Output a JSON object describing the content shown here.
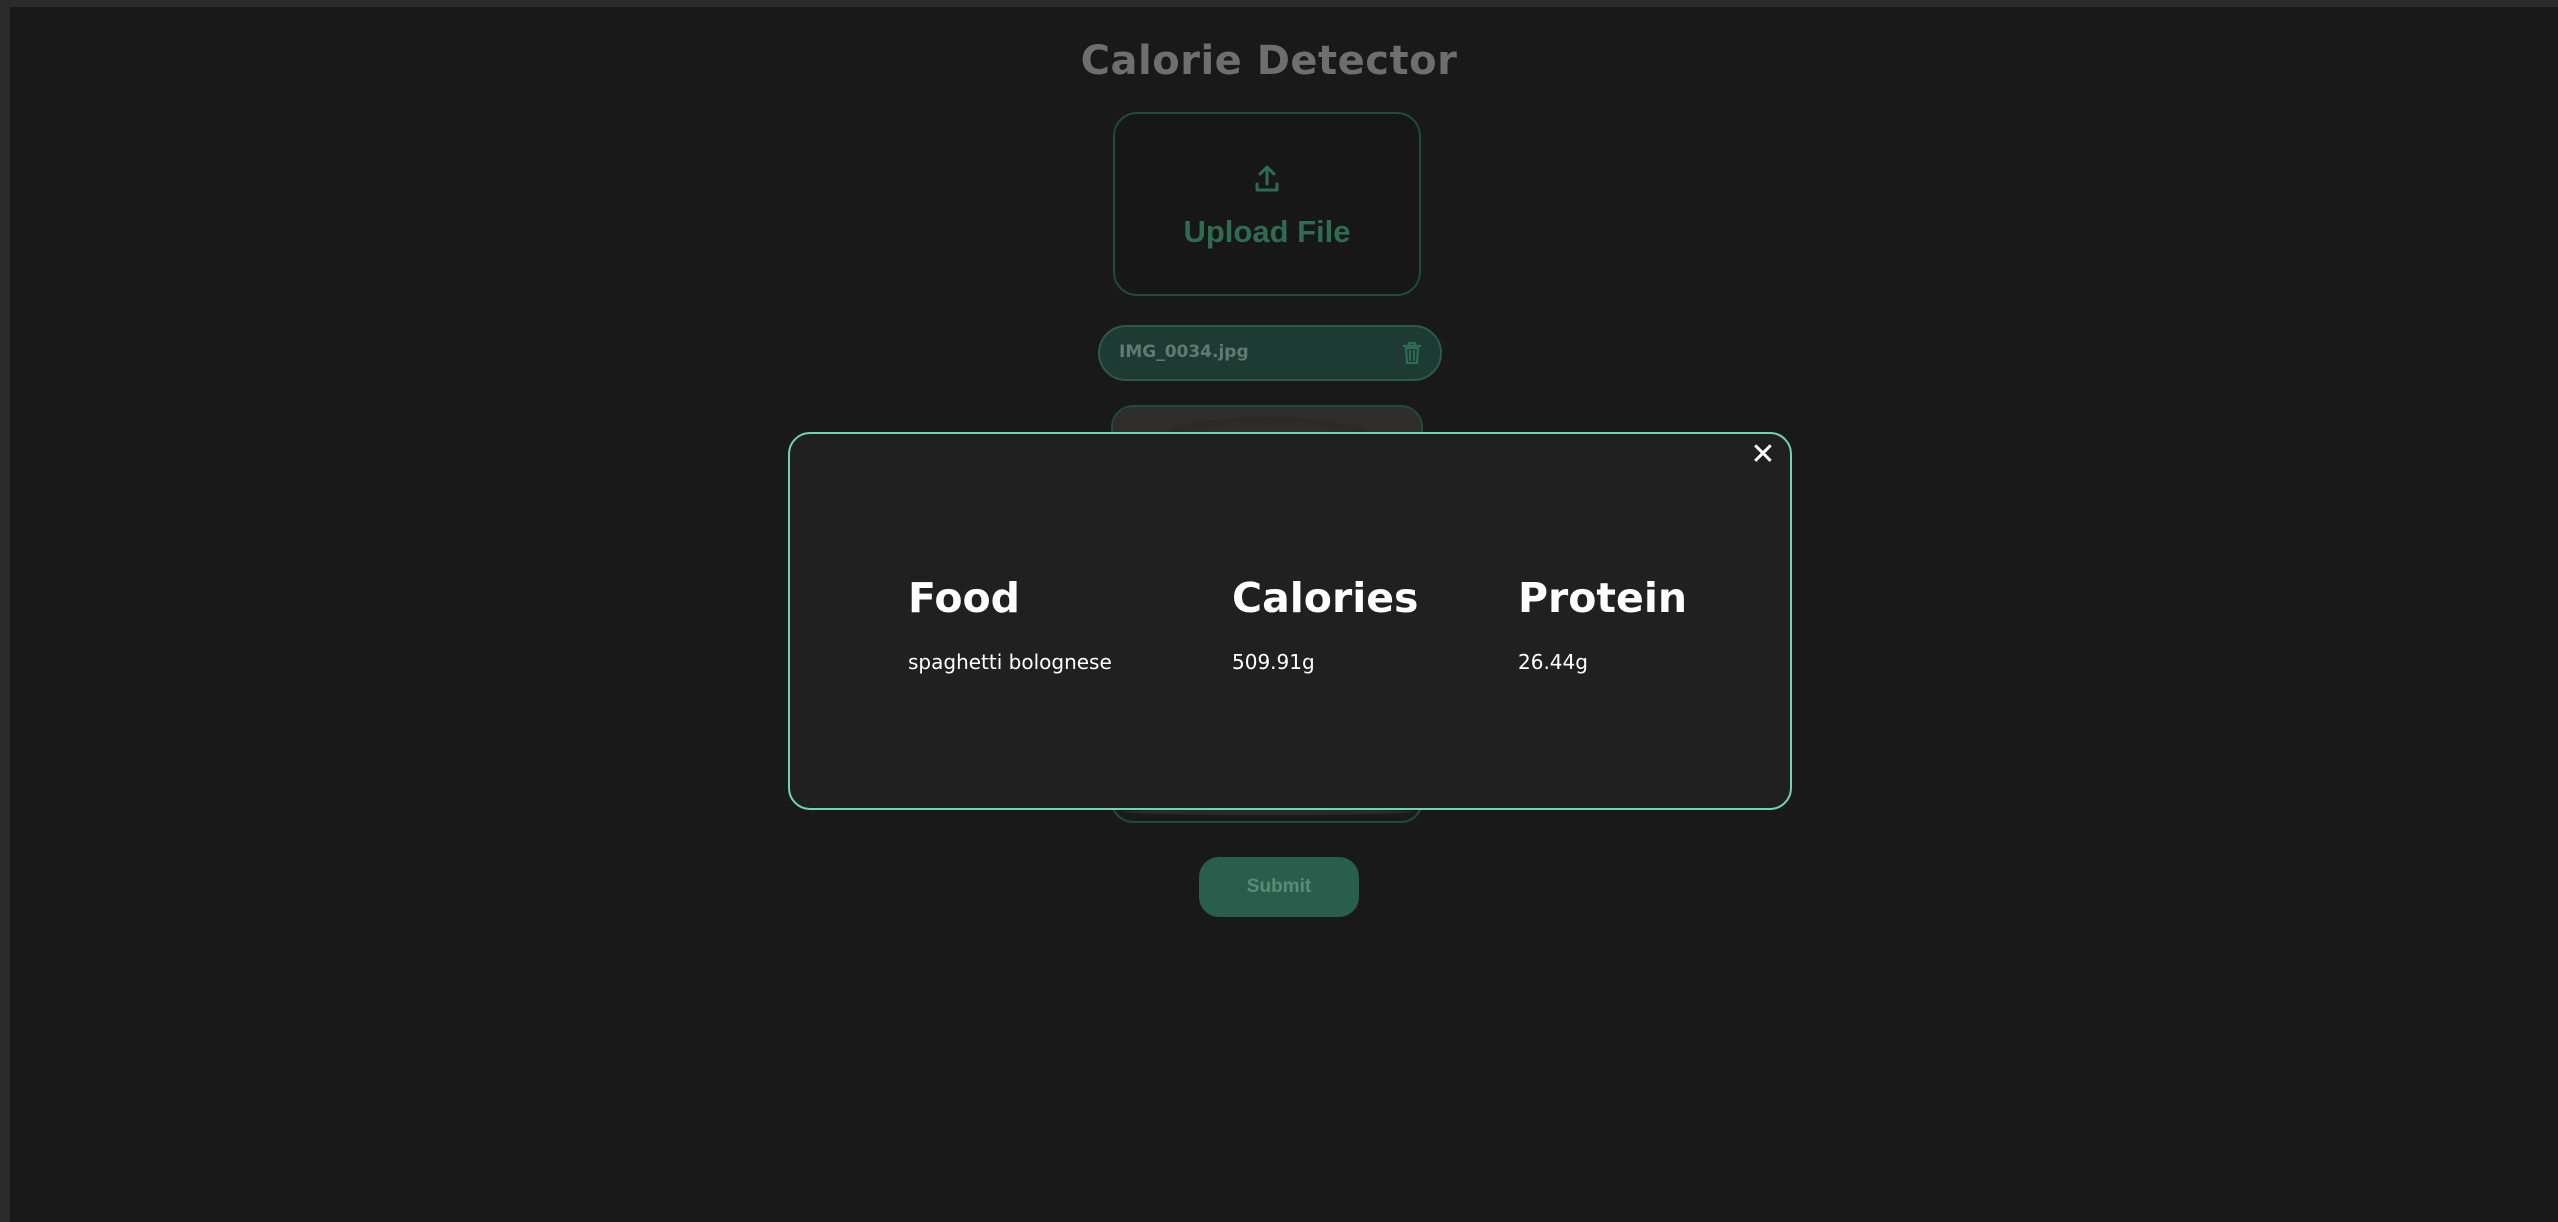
{
  "app": {
    "title": "Calorie Detector"
  },
  "upload": {
    "label": "Upload File",
    "icon": "upload-icon"
  },
  "file": {
    "name": "IMG_0034.jpg",
    "delete_icon": "trash-icon"
  },
  "submit": {
    "label": "Submit"
  },
  "modal": {
    "close_label": "✕",
    "columns": [
      {
        "header": "Food",
        "value": "spaghetti bolognese"
      },
      {
        "header": "Calories",
        "value": "509.91g"
      },
      {
        "header": "Protein",
        "value": "26.44g"
      }
    ]
  },
  "colors": {
    "accent": "#6fd4b4",
    "brand_green": "#2e6b55",
    "background": "#191919",
    "modal_background": "#202020"
  }
}
